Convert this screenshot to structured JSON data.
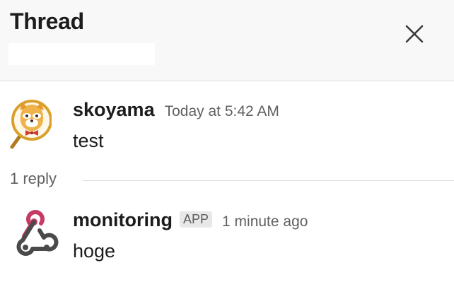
{
  "header": {
    "title": "Thread",
    "close_icon": "close-icon"
  },
  "parent_message": {
    "author": "skoyama",
    "timestamp": "Today at 5:42 AM",
    "text": "test",
    "avatar_icon": "raccoon-avatar"
  },
  "replies": {
    "count_label": "1 reply"
  },
  "reply_message": {
    "author": "monitoring",
    "badge": "APP",
    "timestamp": "1 minute ago",
    "text": "hoge",
    "avatar_icon": "webhook-icon"
  },
  "colors": {
    "header_bg": "#f8f8f8",
    "webhook_pink": "#c73a63",
    "webhook_dark": "#4a4a4a",
    "avatar_ring": "#d9a12b"
  }
}
